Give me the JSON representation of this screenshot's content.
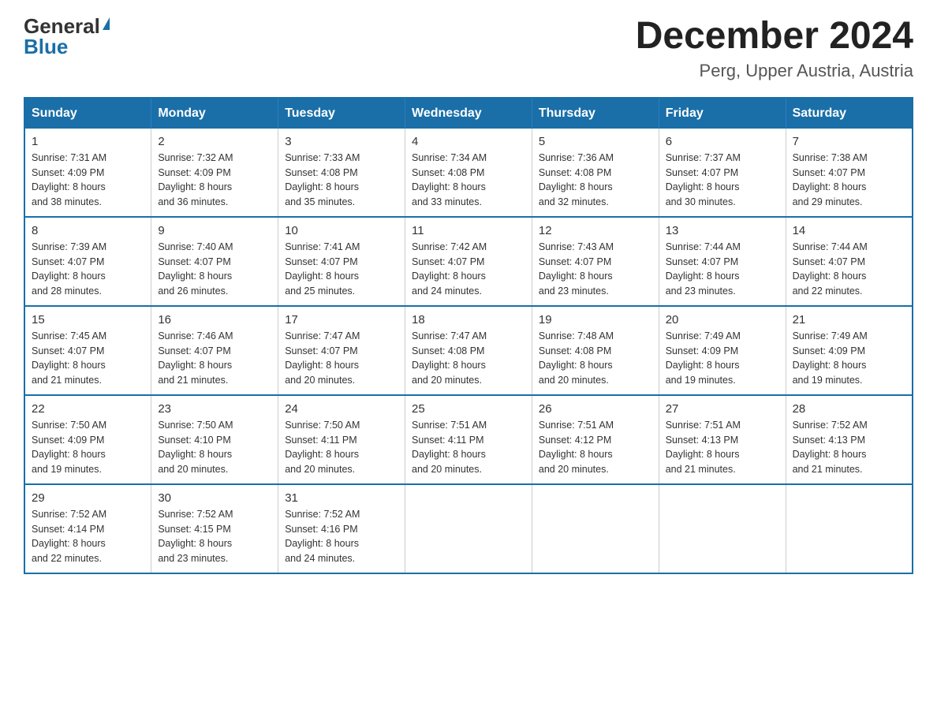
{
  "header": {
    "logo_general": "General",
    "logo_blue": "Blue",
    "main_title": "December 2024",
    "subtitle": "Perg, Upper Austria, Austria"
  },
  "days_of_week": [
    "Sunday",
    "Monday",
    "Tuesday",
    "Wednesday",
    "Thursday",
    "Friday",
    "Saturday"
  ],
  "weeks": [
    [
      {
        "day": "1",
        "sunrise": "7:31 AM",
        "sunset": "4:09 PM",
        "daylight": "8 hours and 38 minutes."
      },
      {
        "day": "2",
        "sunrise": "7:32 AM",
        "sunset": "4:09 PM",
        "daylight": "8 hours and 36 minutes."
      },
      {
        "day": "3",
        "sunrise": "7:33 AM",
        "sunset": "4:08 PM",
        "daylight": "8 hours and 35 minutes."
      },
      {
        "day": "4",
        "sunrise": "7:34 AM",
        "sunset": "4:08 PM",
        "daylight": "8 hours and 33 minutes."
      },
      {
        "day": "5",
        "sunrise": "7:36 AM",
        "sunset": "4:08 PM",
        "daylight": "8 hours and 32 minutes."
      },
      {
        "day": "6",
        "sunrise": "7:37 AM",
        "sunset": "4:07 PM",
        "daylight": "8 hours and 30 minutes."
      },
      {
        "day": "7",
        "sunrise": "7:38 AM",
        "sunset": "4:07 PM",
        "daylight": "8 hours and 29 minutes."
      }
    ],
    [
      {
        "day": "8",
        "sunrise": "7:39 AM",
        "sunset": "4:07 PM",
        "daylight": "8 hours and 28 minutes."
      },
      {
        "day": "9",
        "sunrise": "7:40 AM",
        "sunset": "4:07 PM",
        "daylight": "8 hours and 26 minutes."
      },
      {
        "day": "10",
        "sunrise": "7:41 AM",
        "sunset": "4:07 PM",
        "daylight": "8 hours and 25 minutes."
      },
      {
        "day": "11",
        "sunrise": "7:42 AM",
        "sunset": "4:07 PM",
        "daylight": "8 hours and 24 minutes."
      },
      {
        "day": "12",
        "sunrise": "7:43 AM",
        "sunset": "4:07 PM",
        "daylight": "8 hours and 23 minutes."
      },
      {
        "day": "13",
        "sunrise": "7:44 AM",
        "sunset": "4:07 PM",
        "daylight": "8 hours and 23 minutes."
      },
      {
        "day": "14",
        "sunrise": "7:44 AM",
        "sunset": "4:07 PM",
        "daylight": "8 hours and 22 minutes."
      }
    ],
    [
      {
        "day": "15",
        "sunrise": "7:45 AM",
        "sunset": "4:07 PM",
        "daylight": "8 hours and 21 minutes."
      },
      {
        "day": "16",
        "sunrise": "7:46 AM",
        "sunset": "4:07 PM",
        "daylight": "8 hours and 21 minutes."
      },
      {
        "day": "17",
        "sunrise": "7:47 AM",
        "sunset": "4:07 PM",
        "daylight": "8 hours and 20 minutes."
      },
      {
        "day": "18",
        "sunrise": "7:47 AM",
        "sunset": "4:08 PM",
        "daylight": "8 hours and 20 minutes."
      },
      {
        "day": "19",
        "sunrise": "7:48 AM",
        "sunset": "4:08 PM",
        "daylight": "8 hours and 20 minutes."
      },
      {
        "day": "20",
        "sunrise": "7:49 AM",
        "sunset": "4:09 PM",
        "daylight": "8 hours and 19 minutes."
      },
      {
        "day": "21",
        "sunrise": "7:49 AM",
        "sunset": "4:09 PM",
        "daylight": "8 hours and 19 minutes."
      }
    ],
    [
      {
        "day": "22",
        "sunrise": "7:50 AM",
        "sunset": "4:09 PM",
        "daylight": "8 hours and 19 minutes."
      },
      {
        "day": "23",
        "sunrise": "7:50 AM",
        "sunset": "4:10 PM",
        "daylight": "8 hours and 20 minutes."
      },
      {
        "day": "24",
        "sunrise": "7:50 AM",
        "sunset": "4:11 PM",
        "daylight": "8 hours and 20 minutes."
      },
      {
        "day": "25",
        "sunrise": "7:51 AM",
        "sunset": "4:11 PM",
        "daylight": "8 hours and 20 minutes."
      },
      {
        "day": "26",
        "sunrise": "7:51 AM",
        "sunset": "4:12 PM",
        "daylight": "8 hours and 20 minutes."
      },
      {
        "day": "27",
        "sunrise": "7:51 AM",
        "sunset": "4:13 PM",
        "daylight": "8 hours and 21 minutes."
      },
      {
        "day": "28",
        "sunrise": "7:52 AM",
        "sunset": "4:13 PM",
        "daylight": "8 hours and 21 minutes."
      }
    ],
    [
      {
        "day": "29",
        "sunrise": "7:52 AM",
        "sunset": "4:14 PM",
        "daylight": "8 hours and 22 minutes."
      },
      {
        "day": "30",
        "sunrise": "7:52 AM",
        "sunset": "4:15 PM",
        "daylight": "8 hours and 23 minutes."
      },
      {
        "day": "31",
        "sunrise": "7:52 AM",
        "sunset": "4:16 PM",
        "daylight": "8 hours and 24 minutes."
      },
      null,
      null,
      null,
      null
    ]
  ]
}
